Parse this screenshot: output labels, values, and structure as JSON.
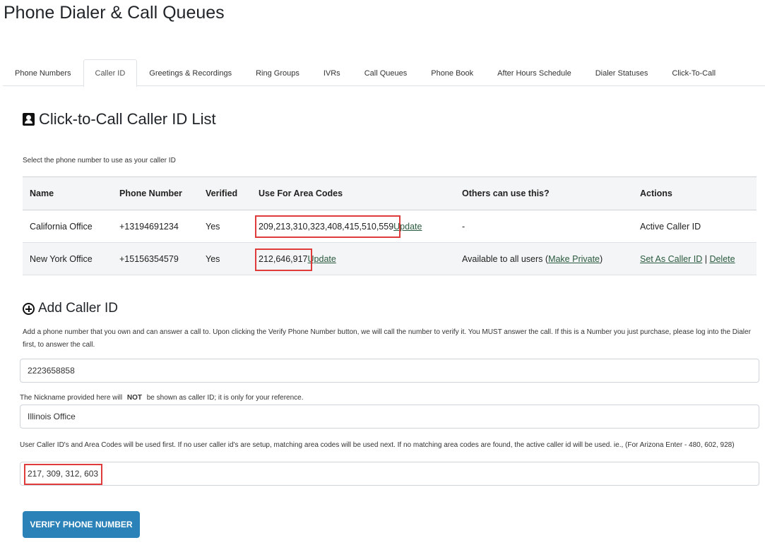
{
  "page": {
    "title": "Phone Dialer & Call Queues"
  },
  "tabs": [
    {
      "label": "Phone Numbers",
      "active": false
    },
    {
      "label": "Caller ID",
      "active": true
    },
    {
      "label": "Greetings & Recordings",
      "active": false
    },
    {
      "label": "Ring Groups",
      "active": false
    },
    {
      "label": "IVRs",
      "active": false
    },
    {
      "label": "Call Queues",
      "active": false
    },
    {
      "label": "Phone Book",
      "active": false
    },
    {
      "label": "After Hours Schedule",
      "active": false
    },
    {
      "label": "Dialer Statuses",
      "active": false
    },
    {
      "label": "Click-To-Call",
      "active": false
    }
  ],
  "list": {
    "title": "Click-to-Call Caller ID List",
    "icon": "contact-card-icon",
    "instruction": "Select the phone number to use as your caller ID",
    "columns": [
      "Name",
      "Phone Number",
      "Verified",
      "Use For Area Codes",
      "Others can use this?",
      "Actions"
    ],
    "rows": [
      {
        "name": "California Office",
        "phone": "+13194691234",
        "verified": "Yes",
        "area_codes": "209,213,310,323,408,415,510,559",
        "update_label": "Update",
        "others": "-",
        "action": "Active Caller ID"
      },
      {
        "name": "New York Office",
        "phone": "+15156354579",
        "verified": "Yes",
        "area_codes": "212,646,917",
        "update_label": "Update",
        "others_prefix": "Available to all users (",
        "others_link": "Make Private",
        "others_suffix": ")",
        "set_caller_label": "Set As Caller ID",
        "separator": "|",
        "delete_label": "Delete"
      }
    ]
  },
  "add": {
    "title": "Add Caller ID",
    "icon": "plus-circle-icon",
    "description": "Add a phone number that you own and can answer a call to. Upon clicking the Verify Phone Number button, we will call the number to verify it. You MUST answer the call. If this is a Number you just purchase, please log into the Dialer first, to answer the call.",
    "phone_value": "2223658858",
    "nickname_note_prefix": "The Nickname provided here will",
    "nickname_note_bold": "NOT",
    "nickname_note_suffix": "be shown as caller ID; it is only for your reference.",
    "nickname_value": "Illinois Office",
    "area_codes_note": "User Caller ID's and Area Codes will be used first. If no user caller id's are setup, matching area codes will be used next. If no matching area codes are found, the active caller id will be used. ie., (For Arizona Enter - 480, 602, 928)",
    "area_codes_value": "217, 309, 312, 603",
    "verify_button": "VERIFY PHONE NUMBER"
  },
  "colors": {
    "primary_button": "#2a82b8",
    "highlight_box": "#e03b3b",
    "link": "#2a5a3f"
  }
}
